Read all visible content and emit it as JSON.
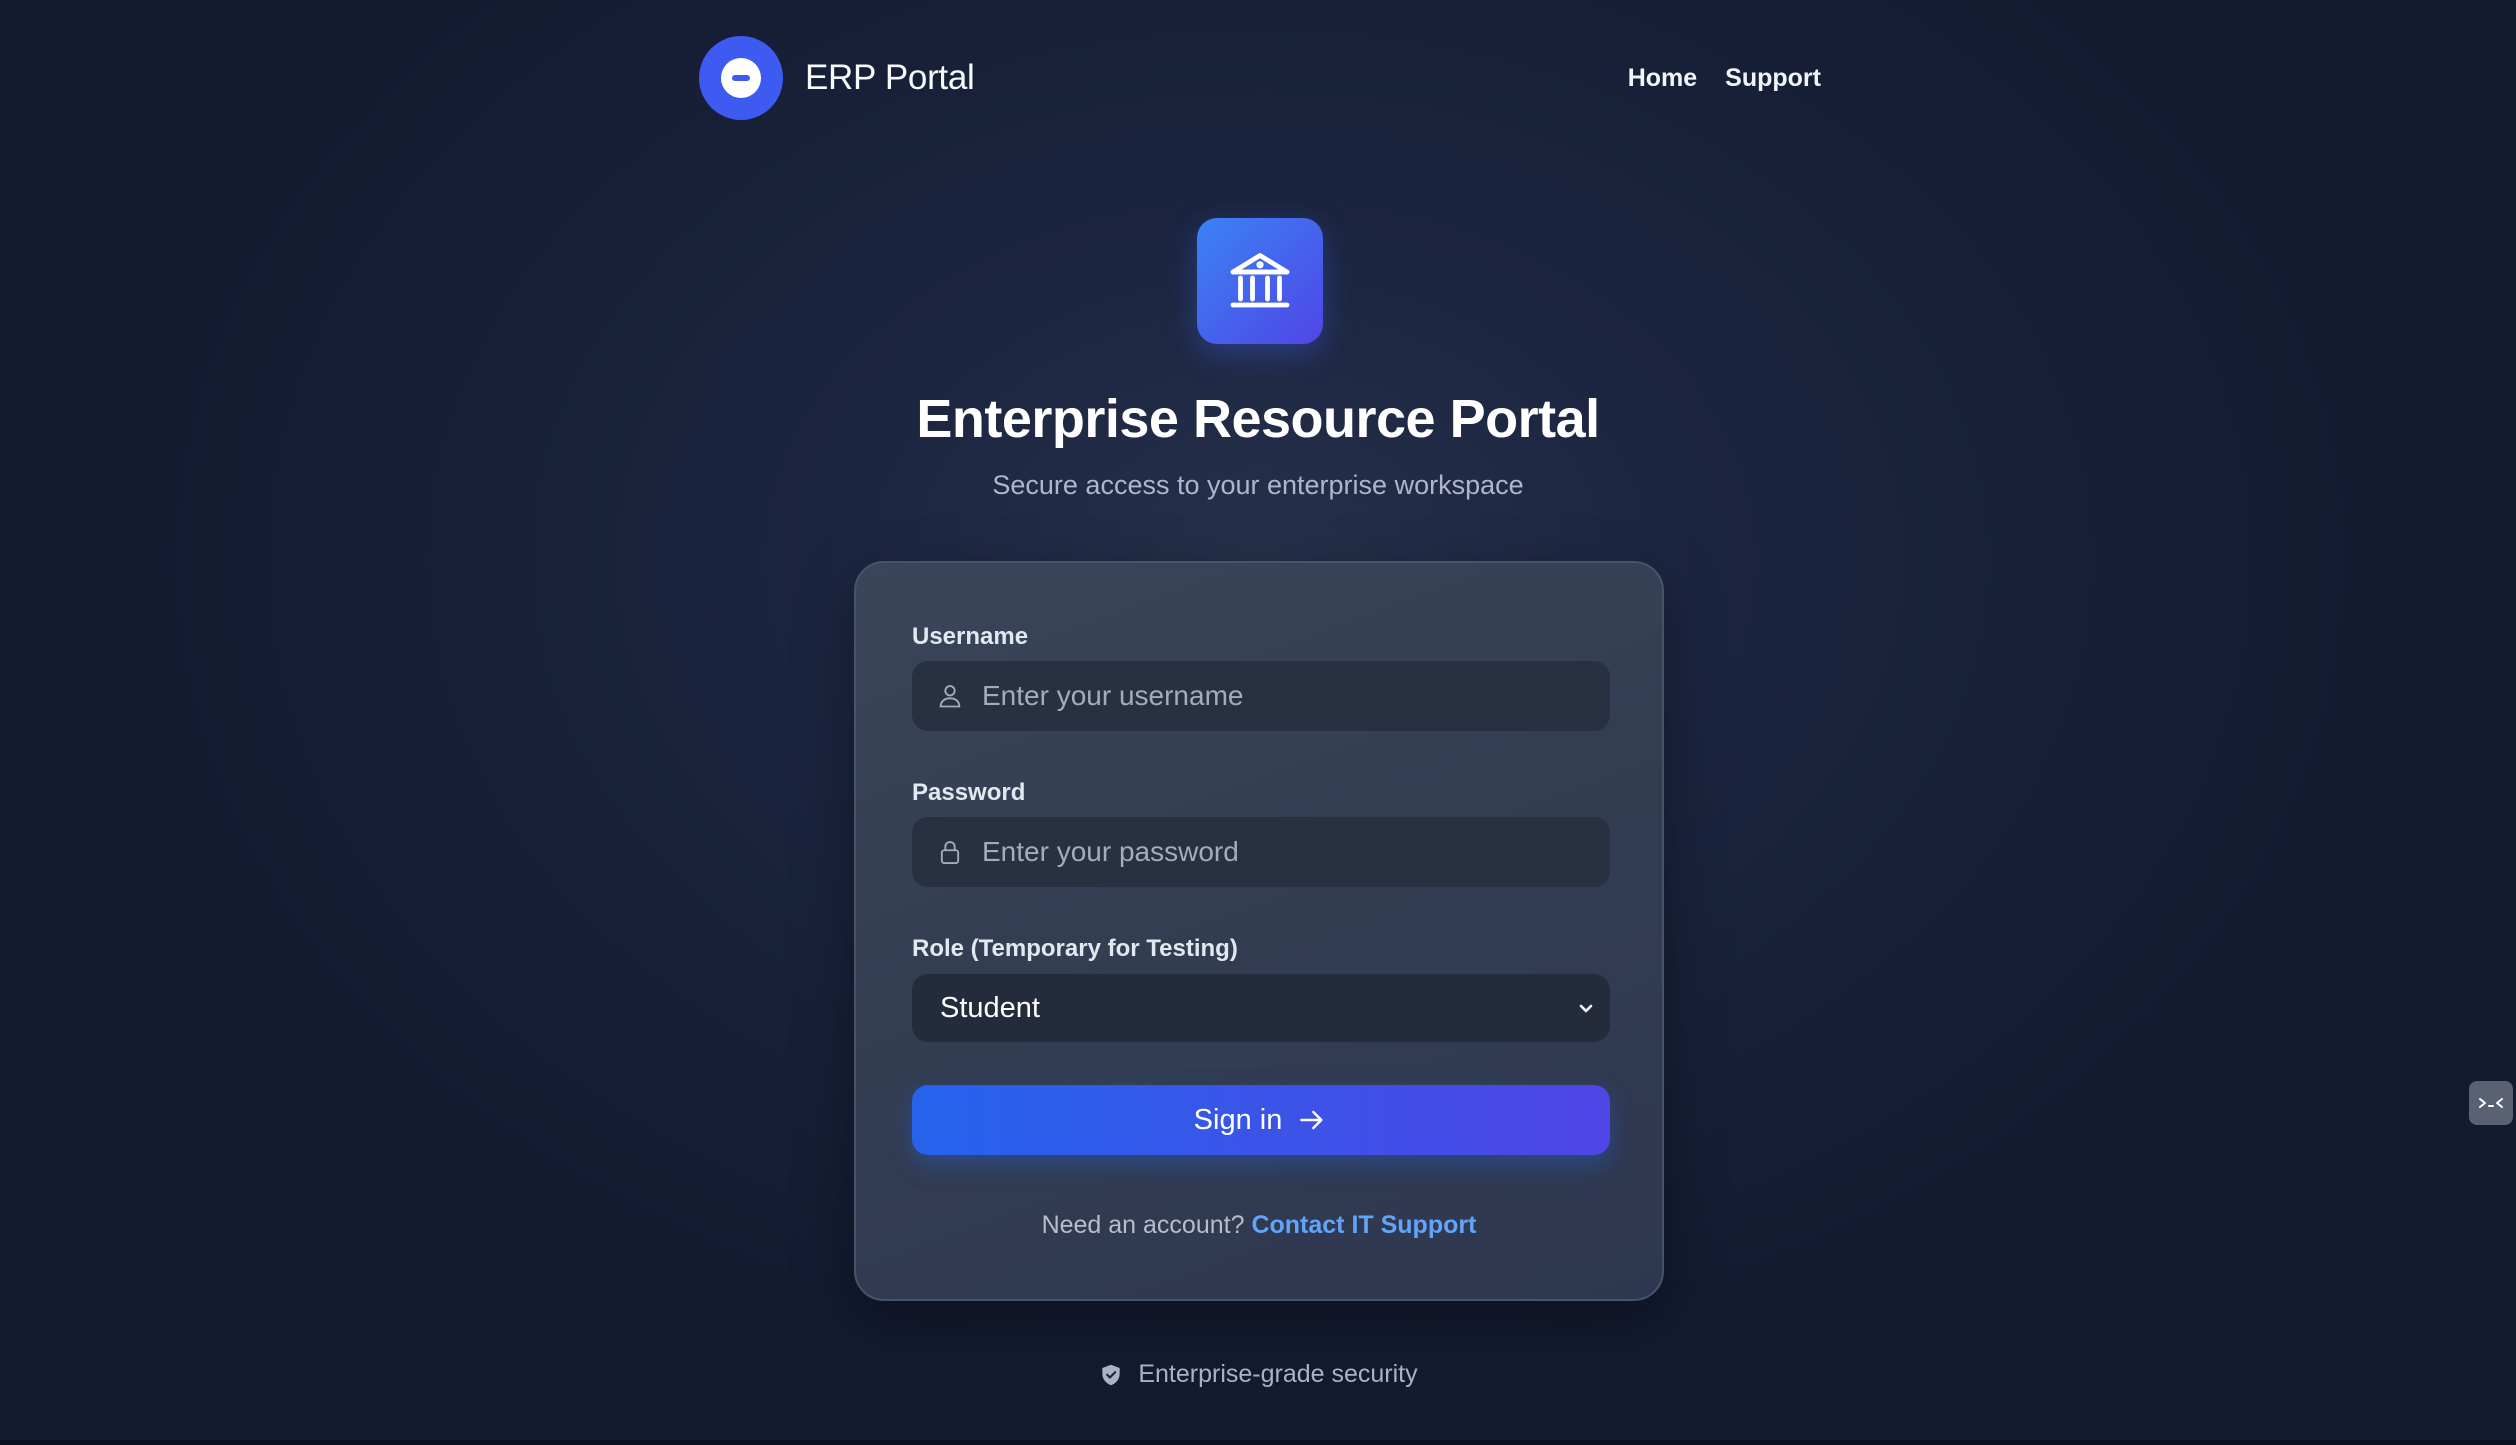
{
  "header": {
    "brand": "ERP Portal",
    "nav": [
      {
        "label": "Home"
      },
      {
        "label": "Support"
      }
    ]
  },
  "hero": {
    "icon": "bank-building-icon",
    "title": "Enterprise Resource Portal",
    "subtitle": "Secure access to your enterprise workspace"
  },
  "form": {
    "username": {
      "label": "Username",
      "placeholder": "Enter your username",
      "value": "",
      "icon": "user-icon"
    },
    "password": {
      "label": "Password",
      "placeholder": "Enter your password",
      "value": "",
      "icon": "lock-icon"
    },
    "role": {
      "label": "Role (Temporary for Testing)",
      "selected": "Student",
      "icon": "chevron-down-icon"
    },
    "submit_label": "Sign in",
    "account_prompt": "Need an account?",
    "account_link": "Contact IT Support"
  },
  "footer": {
    "security_note": "Enterprise-grade security",
    "icon": "shield-check-icon"
  },
  "colors": {
    "accent": "#3d5bf0",
    "button_start": "#2563eb",
    "button_end": "#4f46e5",
    "link": "#60a5fa",
    "background": "#1c2540"
  }
}
